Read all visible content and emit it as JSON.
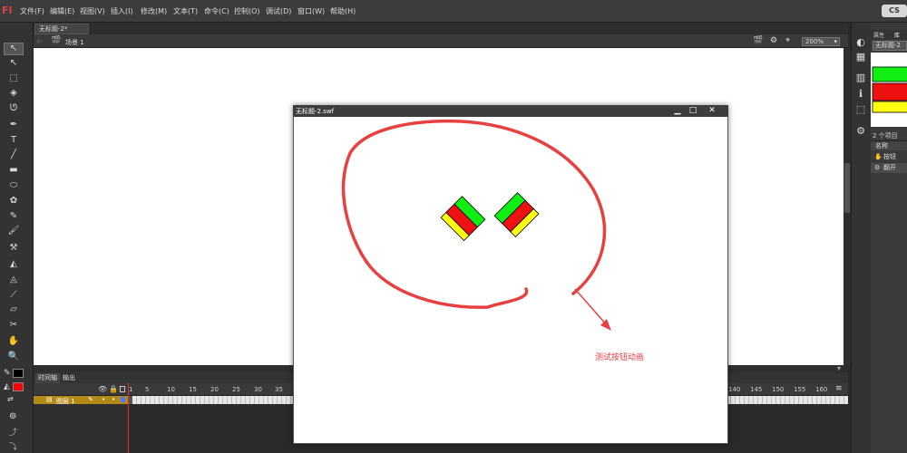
{
  "app": {
    "logo": "Fl",
    "toggle_label": "CS"
  },
  "menu": [
    "文件(F)",
    "编辑(E)",
    "视图(V)",
    "插入(I)",
    "修改(M)",
    "文本(T)",
    "命令(C)",
    "控制(O)",
    "调试(D)",
    "窗口(W)",
    "帮助(H)"
  ],
  "document": {
    "tab_label": "无标题-2*",
    "scene_label": "场景 1",
    "zoom": "200%"
  },
  "timeline": {
    "tabs": [
      "时间轴",
      "输出"
    ],
    "layer_name": "图层 1",
    "frame_numbers_left": [
      "1",
      "5",
      "10",
      "15",
      "20",
      "25",
      "30",
      "35"
    ],
    "frame_numbers_right": [
      "140",
      "145",
      "150",
      "155",
      "160"
    ]
  },
  "library": {
    "tabs": [
      "属性",
      "库"
    ],
    "doc_name": "无标题-2",
    "item_count": "2 个项目",
    "name_header": "名称",
    "items": [
      "按钮",
      "翻开"
    ]
  },
  "swf_window": {
    "title": "无标题-2.swf",
    "minimize": "▁",
    "maximize": "□",
    "close": "✕"
  },
  "annotation": "测试按钮动画",
  "colors": {
    "green": "#11ee11",
    "red": "#ee1111",
    "yellow": "#ffff11",
    "annotation": "#e84040",
    "layer": "#b38a18"
  },
  "tools": [
    "selection-icon",
    "subselection-icon",
    "free-transform-icon",
    "3d-rotation-icon",
    "lasso-icon",
    "pen-icon",
    "text-icon",
    "line-icon",
    "rectangle-icon",
    "oval-icon",
    "deco-icon",
    "pencil-icon",
    "brush-icon",
    "bone-icon",
    "paint-bucket-icon",
    "ink-bottle-icon",
    "eyedropper-icon",
    "eraser-icon",
    "hand-icon",
    "zoom-icon"
  ]
}
